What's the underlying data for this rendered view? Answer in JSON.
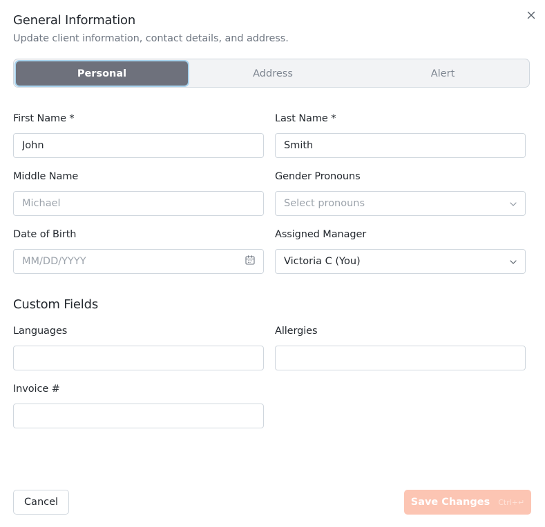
{
  "dialog": {
    "title": "General Information",
    "subtitle": "Update client information, contact details, and address.",
    "close_icon": "close-icon"
  },
  "tabs": [
    {
      "label": "Personal",
      "active": true
    },
    {
      "label": "Address",
      "active": false
    },
    {
      "label": "Alert",
      "active": false
    }
  ],
  "personal": {
    "first_name": {
      "label": "First Name *",
      "value": "John"
    },
    "last_name": {
      "label": "Last Name *",
      "value": "Smith"
    },
    "middle_name": {
      "label": "Middle Name",
      "placeholder": "Michael"
    },
    "pronouns": {
      "label": "Gender Pronouns",
      "placeholder": "Select pronouns",
      "icon": "chevron-down-icon"
    },
    "dob": {
      "label": "Date of Birth",
      "placeholder": "MM/DD/YYYY",
      "icon": "calendar-icon"
    },
    "manager": {
      "label": "Assigned Manager",
      "value": "Victoria C (You)",
      "icon": "chevron-down-icon"
    }
  },
  "custom_fields": {
    "title": "Custom Fields",
    "languages": {
      "label": "Languages",
      "value": ""
    },
    "allergies": {
      "label": "Allergies",
      "value": ""
    },
    "invoice": {
      "label": "Invoice #",
      "value": ""
    }
  },
  "footer": {
    "cancel_label": "Cancel",
    "save_label": "Save Changes",
    "save_shortcut": "Ctrl+↵"
  },
  "colors": {
    "active_tab": "#6e717c",
    "active_tab_ring": "#a8d3ee",
    "save_button": "#fcc5b3"
  }
}
